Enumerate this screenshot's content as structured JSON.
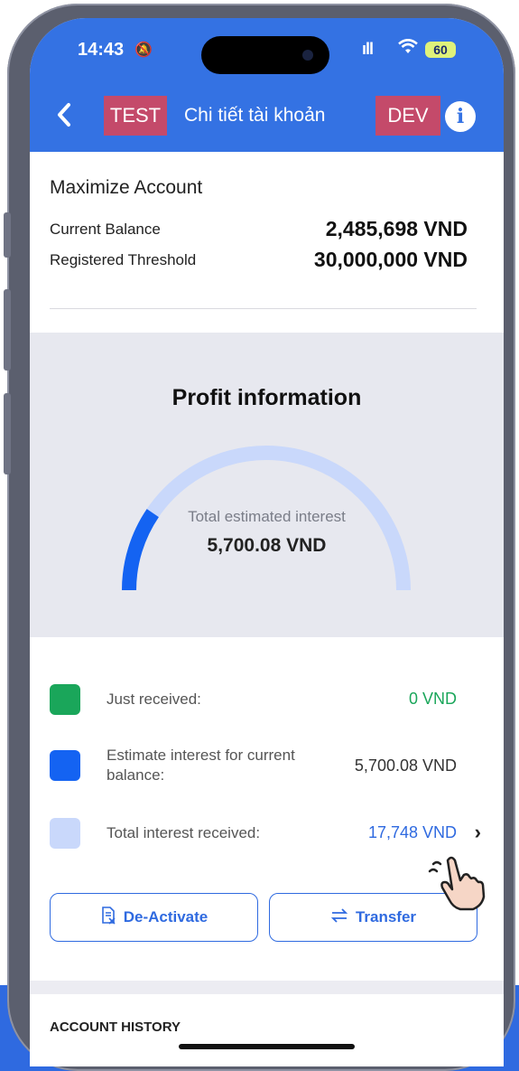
{
  "status_bar": {
    "time": "14:43",
    "battery": "60"
  },
  "header": {
    "tag_left": "TEST",
    "title": "Chi tiết tài khoản",
    "tag_right": "DEV"
  },
  "account": {
    "name": "Maximize Account",
    "balance_label": "Current Balance",
    "balance_value": "2,485,698 VND",
    "threshold_label": "Registered Threshold",
    "threshold_value": "30,000,000 VND"
  },
  "profit": {
    "title": "Profit information",
    "gauge_label": "Total estimated interest",
    "gauge_value": "5,700.08 VND",
    "gauge_fill_fraction": 0.19
  },
  "legend": [
    {
      "label": "Just received:",
      "value": "0 VND",
      "color": "#1aa65a",
      "value_color": "#1aa65a"
    },
    {
      "label": "Estimate interest for current balance:",
      "value": "5,700.08 VND",
      "color": "#1463f2",
      "value_color": "#333333"
    },
    {
      "label": "Total interest received:",
      "value": "17,748 VND",
      "color": "#c9d8fb",
      "value_color": "#2f6ae0"
    }
  ],
  "actions": {
    "deactivate": "De-Activate",
    "transfer": "Transfer"
  },
  "history": {
    "title": "ACCOUNT HISTORY"
  },
  "colors": {
    "primary": "#3472e3",
    "tag": "#c44a6a",
    "gauge_track": "#c9d8fb",
    "gauge_fill": "#1463f2"
  }
}
